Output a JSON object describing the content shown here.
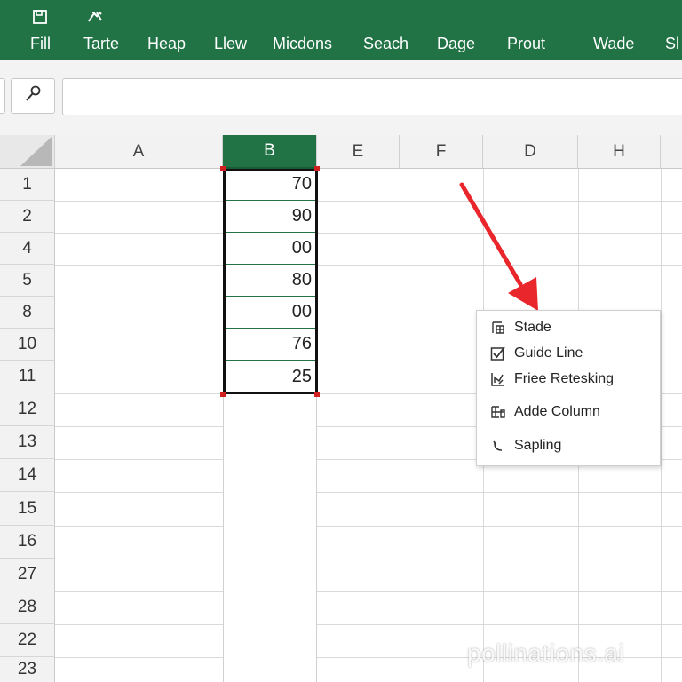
{
  "ribbon": {
    "quick_icons": [
      "save-icon",
      "redo-icon"
    ],
    "tabs": [
      "Fill",
      "Tarte",
      "Heap",
      "Llew",
      "Micdons",
      "Seach",
      "Dage",
      "Prout",
      "Wade",
      "Sl"
    ]
  },
  "formula_bar": {
    "value": ""
  },
  "columns": [
    "A",
    "B",
    "E",
    "F",
    "D",
    "H"
  ],
  "selected_column": "B",
  "rows": [
    "1",
    "2",
    "4",
    "5",
    "8",
    "10",
    "11",
    "12",
    "13",
    "14",
    "15",
    "16",
    "27",
    "28",
    "22",
    "23"
  ],
  "column_b_values": [
    "70",
    "90",
    "00",
    "80",
    "00",
    "76",
    "25"
  ],
  "context_menu": {
    "items": [
      {
        "label": "Stade",
        "icon": "table-icon"
      },
      {
        "label": "Guide Line",
        "icon": "checkbox-icon"
      },
      {
        "label": "Friee Retesking",
        "icon": "chart-icon"
      },
      {
        "label": "Adde Column",
        "icon": "columns-icon"
      },
      {
        "label": "Sapling",
        "icon": "curve-icon"
      }
    ]
  },
  "annotation": {
    "arrow_color": "#e8262b"
  },
  "colors": {
    "accent": "#217346"
  },
  "watermark": "pollinations.ai"
}
